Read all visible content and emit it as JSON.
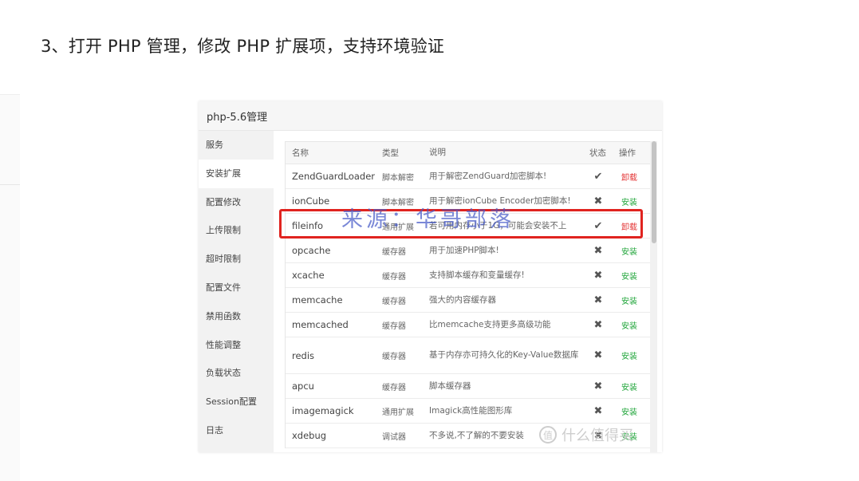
{
  "article": {
    "step_title": "3、打开 PHP 管理，修改 PHP 扩展项，支持环境验证"
  },
  "panel": {
    "title": "php-5.6管理",
    "menu": [
      {
        "label": "服务",
        "active": false
      },
      {
        "label": "安装扩展",
        "active": true
      },
      {
        "label": "配置修改",
        "active": false
      },
      {
        "label": "上传限制",
        "active": false
      },
      {
        "label": "超时限制",
        "active": false
      },
      {
        "label": "配置文件",
        "active": false
      },
      {
        "label": "禁用函数",
        "active": false
      },
      {
        "label": "性能调整",
        "active": false
      },
      {
        "label": "负载状态",
        "active": false
      },
      {
        "label": "Session配置",
        "active": false
      },
      {
        "label": "日志",
        "active": false
      }
    ],
    "table": {
      "headers": {
        "name": "名称",
        "type": "类型",
        "desc": "说明",
        "status": "状态",
        "op": "操作"
      },
      "rows": [
        {
          "name": "ZendGuardLoader",
          "type": "脚本解密",
          "desc": "用于解密ZendGuard加密脚本!",
          "status": "✔",
          "status_name": "check-icon",
          "op": "卸载",
          "op_kind": "uninstall"
        },
        {
          "name": "ionCube",
          "type": "脚本解密",
          "desc": "用于解密ionCube Encoder加密脚本!",
          "status": "✖",
          "status_name": "cross-icon",
          "op": "安装",
          "op_kind": "install"
        },
        {
          "name": "fileinfo",
          "type": "通用扩展",
          "desc": "若可用内存小于1G，可能会安装不上",
          "status": "✔",
          "status_name": "check-icon",
          "op": "卸载",
          "op_kind": "uninstall"
        },
        {
          "name": "opcache",
          "type": "缓存器",
          "desc": "用于加速PHP脚本!",
          "status": "✖",
          "status_name": "cross-icon",
          "op": "安装",
          "op_kind": "install"
        },
        {
          "name": "xcache",
          "type": "缓存器",
          "desc": "支持脚本缓存和变量缓存!",
          "status": "✖",
          "status_name": "cross-icon",
          "op": "安装",
          "op_kind": "install"
        },
        {
          "name": "memcache",
          "type": "缓存器",
          "desc": "强大的内容缓存器",
          "status": "✖",
          "status_name": "cross-icon",
          "op": "安装",
          "op_kind": "install"
        },
        {
          "name": "memcached",
          "type": "缓存器",
          "desc": "比memcache支持更多高级功能",
          "status": "✖",
          "status_name": "cross-icon",
          "op": "安装",
          "op_kind": "install"
        },
        {
          "name": "redis",
          "type": "缓存器",
          "desc": "基于内存亦可持久化的Key-Value数据库",
          "status": "✖",
          "status_name": "cross-icon",
          "op": "安装",
          "op_kind": "install",
          "tall": true
        },
        {
          "name": "apcu",
          "type": "缓存器",
          "desc": "脚本缓存器",
          "status": "✖",
          "status_name": "cross-icon",
          "op": "安装",
          "op_kind": "install"
        },
        {
          "name": "imagemagick",
          "type": "通用扩展",
          "desc": "Imagick高性能图形库",
          "status": "✖",
          "status_name": "cross-icon",
          "op": "安装",
          "op_kind": "install"
        },
        {
          "name": "xdebug",
          "type": "调试器",
          "desc": "不多说,不了解的不要安装",
          "status": "✖",
          "status_name": "cross-icon",
          "op": "安装",
          "op_kind": "install"
        }
      ]
    }
  },
  "watermark": {
    "text": "来源：华哥部落"
  },
  "corner_watermark": {
    "logo": "值",
    "text": "什么值得买"
  },
  "colors": {
    "install": "#20a53a",
    "uninstall": "#e33333",
    "highlight": "#e0231f"
  }
}
